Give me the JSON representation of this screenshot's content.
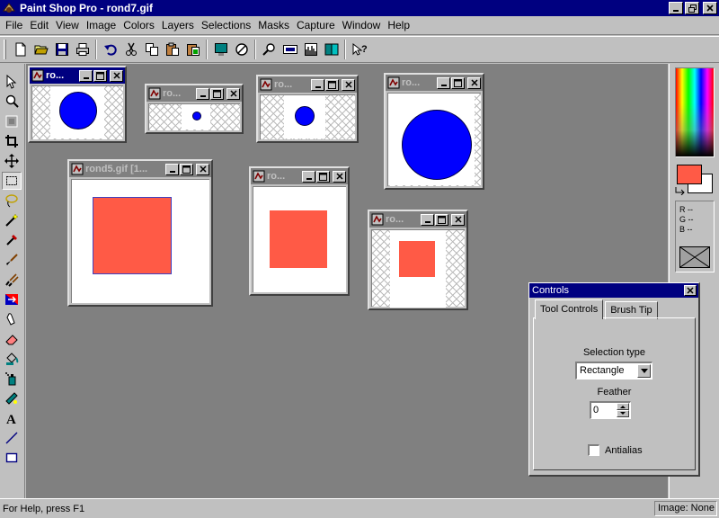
{
  "window": {
    "title": "Paint Shop Pro - rond7.gif"
  },
  "menu": [
    "File",
    "Edit",
    "View",
    "Image",
    "Colors",
    "Layers",
    "Selections",
    "Masks",
    "Capture",
    "Window",
    "Help"
  ],
  "children": [
    {
      "title": "ro..."
    },
    {
      "title": "ro..."
    },
    {
      "title": "ro..."
    },
    {
      "title": "ro..."
    },
    {
      "title": "rond5.gif [1..."
    },
    {
      "title": "ro..."
    },
    {
      "title": "ro..."
    }
  ],
  "colors": {
    "foreground": "#ff5a46",
    "background": "#ffffff",
    "rgb": {
      "r": "R --",
      "g": "G --",
      "b": "B --"
    }
  },
  "controls": {
    "title": "Controls",
    "tabs": [
      "Tool Controls",
      "Brush Tip"
    ],
    "selection_type_label": "Selection type",
    "selection_type_value": "Rectangle",
    "feather_label": "Feather",
    "feather_value": "0",
    "antialias_label": "Antialias",
    "antialias_checked": false
  },
  "status": {
    "help": "For Help, press F1",
    "image": "Image: None"
  }
}
